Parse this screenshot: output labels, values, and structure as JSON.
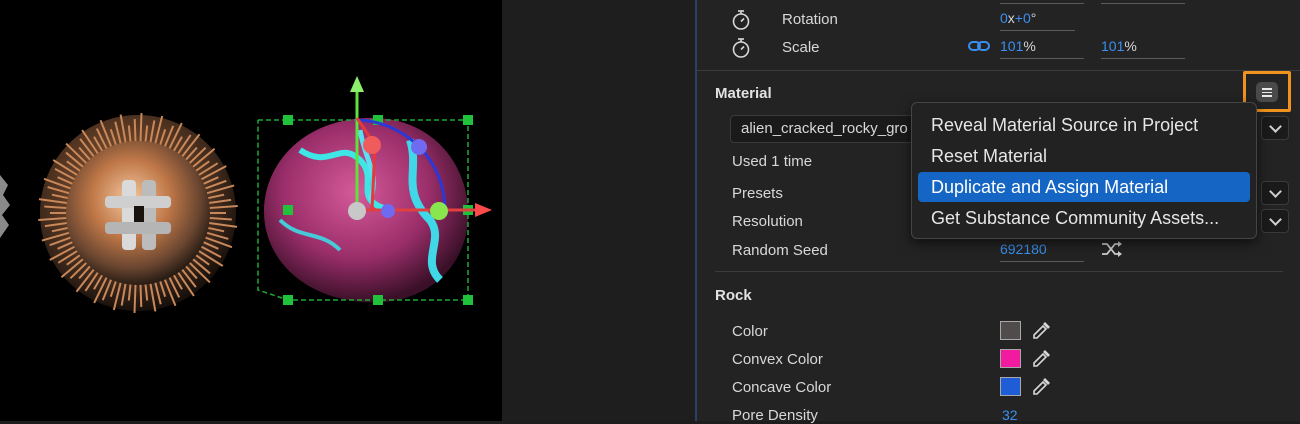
{
  "transform": {
    "rotation": {
      "label": "Rotation",
      "turns": "0",
      "x_sep": "x",
      "degrees": "+0",
      "deg_unit": "°"
    },
    "scale": {
      "label": "Scale",
      "x_value": "101",
      "y_value": "101",
      "unit": "%"
    }
  },
  "material": {
    "title": "Material",
    "selected": "alien_cracked_rocky_gro",
    "used": "Used 1 time",
    "presets_label": "Presets",
    "resolution_label": "Resolution",
    "random_seed_label": "Random Seed",
    "random_seed_value": "692180"
  },
  "menu": {
    "items": [
      {
        "label": "Reveal Material Source in Project",
        "highlighted": false
      },
      {
        "label": "Reset Material",
        "highlighted": false
      },
      {
        "label": "Duplicate and Assign Material",
        "highlighted": true
      },
      {
        "label": "Get Substance Community Assets...",
        "highlighted": false
      }
    ]
  },
  "rock": {
    "title": "Rock",
    "color_label": "Color",
    "color_value": "#4f4c4b",
    "convex_label": "Convex Color",
    "convex_value": "#f21ba0",
    "concave_label": "Concave Color",
    "concave_value": "#1e5dd6",
    "pore_label": "Pore Density",
    "pore_value": "32"
  },
  "colors": {
    "accent_blue": "#3b8ff0",
    "highlight_orange": "#f0931e",
    "menu_highlight": "#1565c4"
  }
}
